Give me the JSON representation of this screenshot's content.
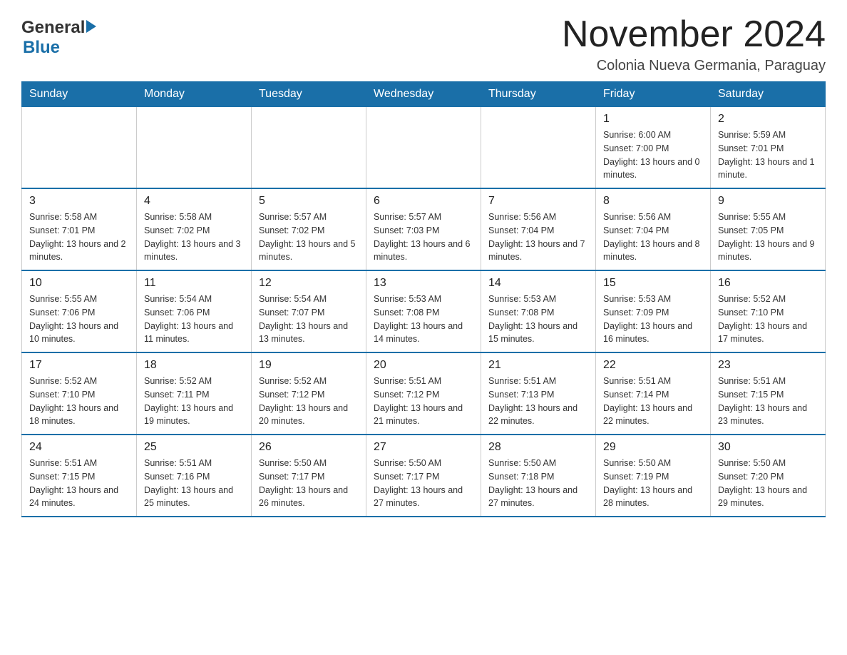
{
  "header": {
    "logo_general": "General",
    "logo_blue": "Blue",
    "month_title": "November 2024",
    "location": "Colonia Nueva Germania, Paraguay"
  },
  "weekdays": [
    "Sunday",
    "Monday",
    "Tuesday",
    "Wednesday",
    "Thursday",
    "Friday",
    "Saturday"
  ],
  "weeks": [
    {
      "days": [
        {
          "number": "",
          "info": ""
        },
        {
          "number": "",
          "info": ""
        },
        {
          "number": "",
          "info": ""
        },
        {
          "number": "",
          "info": ""
        },
        {
          "number": "",
          "info": ""
        },
        {
          "number": "1",
          "info": "Sunrise: 6:00 AM\nSunset: 7:00 PM\nDaylight: 13 hours and 0 minutes."
        },
        {
          "number": "2",
          "info": "Sunrise: 5:59 AM\nSunset: 7:01 PM\nDaylight: 13 hours and 1 minute."
        }
      ]
    },
    {
      "days": [
        {
          "number": "3",
          "info": "Sunrise: 5:58 AM\nSunset: 7:01 PM\nDaylight: 13 hours and 2 minutes."
        },
        {
          "number": "4",
          "info": "Sunrise: 5:58 AM\nSunset: 7:02 PM\nDaylight: 13 hours and 3 minutes."
        },
        {
          "number": "5",
          "info": "Sunrise: 5:57 AM\nSunset: 7:02 PM\nDaylight: 13 hours and 5 minutes."
        },
        {
          "number": "6",
          "info": "Sunrise: 5:57 AM\nSunset: 7:03 PM\nDaylight: 13 hours and 6 minutes."
        },
        {
          "number": "7",
          "info": "Sunrise: 5:56 AM\nSunset: 7:04 PM\nDaylight: 13 hours and 7 minutes."
        },
        {
          "number": "8",
          "info": "Sunrise: 5:56 AM\nSunset: 7:04 PM\nDaylight: 13 hours and 8 minutes."
        },
        {
          "number": "9",
          "info": "Sunrise: 5:55 AM\nSunset: 7:05 PM\nDaylight: 13 hours and 9 minutes."
        }
      ]
    },
    {
      "days": [
        {
          "number": "10",
          "info": "Sunrise: 5:55 AM\nSunset: 7:06 PM\nDaylight: 13 hours and 10 minutes."
        },
        {
          "number": "11",
          "info": "Sunrise: 5:54 AM\nSunset: 7:06 PM\nDaylight: 13 hours and 11 minutes."
        },
        {
          "number": "12",
          "info": "Sunrise: 5:54 AM\nSunset: 7:07 PM\nDaylight: 13 hours and 13 minutes."
        },
        {
          "number": "13",
          "info": "Sunrise: 5:53 AM\nSunset: 7:08 PM\nDaylight: 13 hours and 14 minutes."
        },
        {
          "number": "14",
          "info": "Sunrise: 5:53 AM\nSunset: 7:08 PM\nDaylight: 13 hours and 15 minutes."
        },
        {
          "number": "15",
          "info": "Sunrise: 5:53 AM\nSunset: 7:09 PM\nDaylight: 13 hours and 16 minutes."
        },
        {
          "number": "16",
          "info": "Sunrise: 5:52 AM\nSunset: 7:10 PM\nDaylight: 13 hours and 17 minutes."
        }
      ]
    },
    {
      "days": [
        {
          "number": "17",
          "info": "Sunrise: 5:52 AM\nSunset: 7:10 PM\nDaylight: 13 hours and 18 minutes."
        },
        {
          "number": "18",
          "info": "Sunrise: 5:52 AM\nSunset: 7:11 PM\nDaylight: 13 hours and 19 minutes."
        },
        {
          "number": "19",
          "info": "Sunrise: 5:52 AM\nSunset: 7:12 PM\nDaylight: 13 hours and 20 minutes."
        },
        {
          "number": "20",
          "info": "Sunrise: 5:51 AM\nSunset: 7:12 PM\nDaylight: 13 hours and 21 minutes."
        },
        {
          "number": "21",
          "info": "Sunrise: 5:51 AM\nSunset: 7:13 PM\nDaylight: 13 hours and 22 minutes."
        },
        {
          "number": "22",
          "info": "Sunrise: 5:51 AM\nSunset: 7:14 PM\nDaylight: 13 hours and 22 minutes."
        },
        {
          "number": "23",
          "info": "Sunrise: 5:51 AM\nSunset: 7:15 PM\nDaylight: 13 hours and 23 minutes."
        }
      ]
    },
    {
      "days": [
        {
          "number": "24",
          "info": "Sunrise: 5:51 AM\nSunset: 7:15 PM\nDaylight: 13 hours and 24 minutes."
        },
        {
          "number": "25",
          "info": "Sunrise: 5:51 AM\nSunset: 7:16 PM\nDaylight: 13 hours and 25 minutes."
        },
        {
          "number": "26",
          "info": "Sunrise: 5:50 AM\nSunset: 7:17 PM\nDaylight: 13 hours and 26 minutes."
        },
        {
          "number": "27",
          "info": "Sunrise: 5:50 AM\nSunset: 7:17 PM\nDaylight: 13 hours and 27 minutes."
        },
        {
          "number": "28",
          "info": "Sunrise: 5:50 AM\nSunset: 7:18 PM\nDaylight: 13 hours and 27 minutes."
        },
        {
          "number": "29",
          "info": "Sunrise: 5:50 AM\nSunset: 7:19 PM\nDaylight: 13 hours and 28 minutes."
        },
        {
          "number": "30",
          "info": "Sunrise: 5:50 AM\nSunset: 7:20 PM\nDaylight: 13 hours and 29 minutes."
        }
      ]
    }
  ]
}
